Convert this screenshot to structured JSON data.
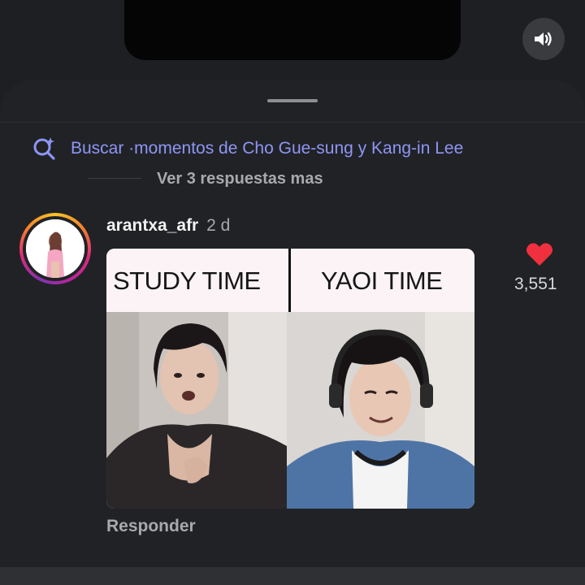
{
  "status_bar": {
    "sound_icon": "speaker-on-icon"
  },
  "sheet": {
    "search_icon": "sparkle-search-icon",
    "search_label": "Buscar ·momentos de Cho Gue-sung y Kang-in Lee",
    "view_replies": "Ver 3 respuestas mas"
  },
  "comment": {
    "username": "arantxa_afr",
    "age": "2 d",
    "meme_left_label": "STUDY TIME",
    "meme_right_label": "YAOI TIME",
    "like_icon": "heart-icon",
    "like_color": "#f0303e",
    "like_count": "3,551",
    "reply_label": "Responder"
  },
  "colors": {
    "accent_link": "#8e96f4",
    "background": "#1e1f23"
  }
}
